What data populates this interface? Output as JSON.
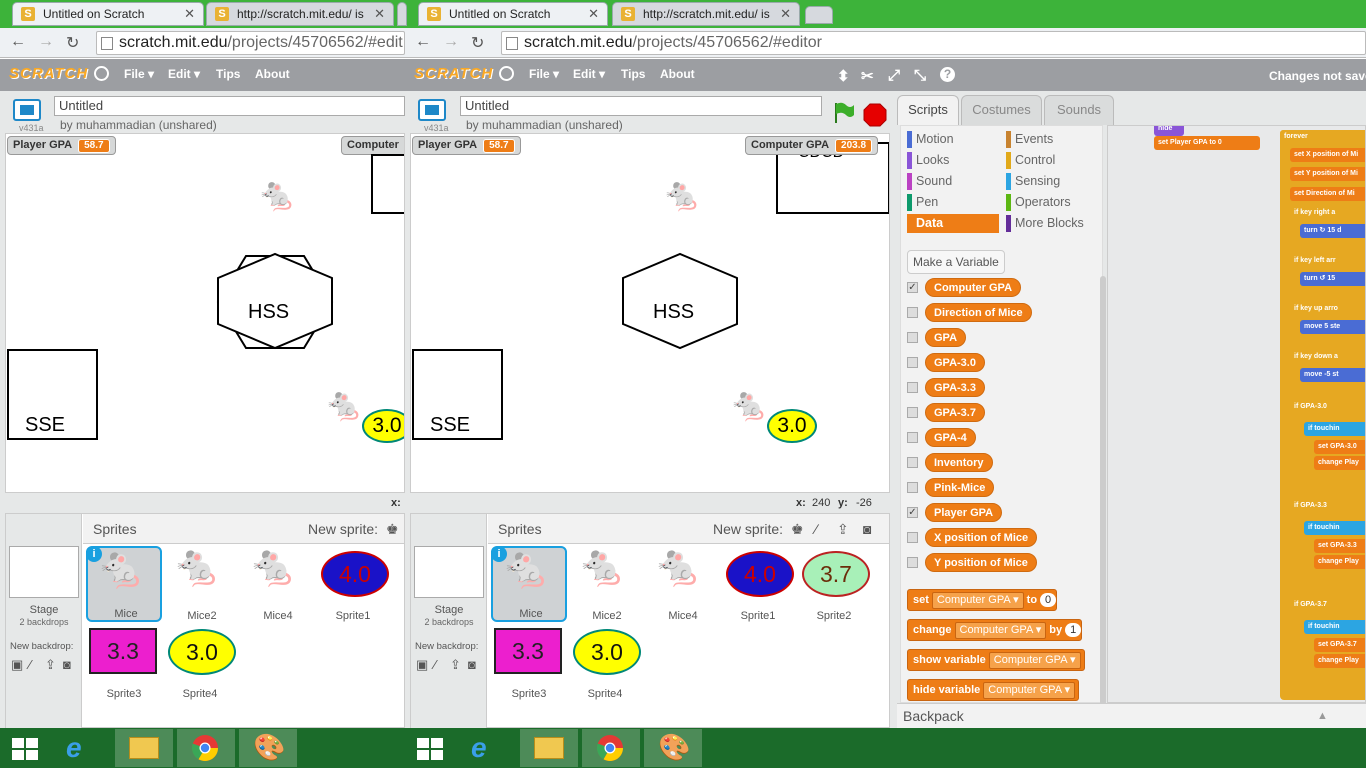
{
  "tabs": [
    {
      "label": "Untitled on Scratch",
      "active": true
    },
    {
      "label": "http://scratch.mit.edu/ is",
      "active": false
    },
    {
      "label": "Untitled on Scratch",
      "active": true
    },
    {
      "label": "http://scratch.mit.edu/ is",
      "active": false
    }
  ],
  "address_left": {
    "host": "scratch.mit.edu",
    "path": "/projects/45706562/#edit"
  },
  "address_right": {
    "host": "scratch.mit.edu",
    "path": "/projects/45706562/#editor"
  },
  "menu": {
    "logo": "SCRATCH",
    "file": "File ▾",
    "edit": "Edit ▾",
    "tips": "Tips",
    "about": "About",
    "status": "Changes not save"
  },
  "project": {
    "title": "Untitled",
    "byline": "by muhammadian (unshared)",
    "version": "v431a"
  },
  "monitors": {
    "player_label": "Player GPA",
    "player_value": "58.7",
    "computer_label": "Computer GPA",
    "computer_value": "203.8",
    "computer_label_short": "Computer"
  },
  "stage": {
    "hss": "HSS",
    "sse": "SSE",
    "cdcd": "CDCD",
    "gpa_sprite": "3.0"
  },
  "coords": {
    "x_label": "x:",
    "x_val": "240",
    "y_label": "y:",
    "y_val": "-26"
  },
  "sprites_panel": {
    "title": "Sprites",
    "new_sprite": "New sprite:",
    "stage_label": "Stage",
    "stage_sub": "2 backdrops",
    "new_backdrop": "New backdrop:"
  },
  "sprites": [
    {
      "name": "Mice",
      "text": ""
    },
    {
      "name": "Mice2",
      "text": ""
    },
    {
      "name": "Mice4",
      "text": ""
    },
    {
      "name": "Sprite1",
      "text": "4.0"
    },
    {
      "name": "Sprite2",
      "text": "3.7"
    },
    {
      "name": "Sprite3",
      "text": "3.3"
    },
    {
      "name": "Sprite4",
      "text": "3.0"
    }
  ],
  "editor_tabs": {
    "scripts": "Scripts",
    "costumes": "Costumes",
    "sounds": "Sounds"
  },
  "categories": [
    {
      "label": "Motion",
      "color": "#4a6cd4"
    },
    {
      "label": "Looks",
      "color": "#8a55d7"
    },
    {
      "label": "Sound",
      "color": "#bb42c3"
    },
    {
      "label": "Pen",
      "color": "#0e9a6c"
    },
    {
      "label": "Data",
      "color": "#ee7d16"
    },
    {
      "label": "Events",
      "color": "#c88330"
    },
    {
      "label": "Control",
      "color": "#e1a91a"
    },
    {
      "label": "Sensing",
      "color": "#2ca5e2"
    },
    {
      "label": "Operators",
      "color": "#5cb712"
    },
    {
      "label": "More Blocks",
      "color": "#632d99"
    }
  ],
  "make_variable": "Make a Variable",
  "variables": [
    {
      "name": "Computer GPA",
      "checked": true
    },
    {
      "name": "Direction of Mice",
      "checked": false
    },
    {
      "name": "GPA",
      "checked": false
    },
    {
      "name": "GPA-3.0",
      "checked": false
    },
    {
      "name": "GPA-3.3",
      "checked": false
    },
    {
      "name": "GPA-3.7",
      "checked": false
    },
    {
      "name": "GPA-4",
      "checked": false
    },
    {
      "name": "Inventory",
      "checked": false
    },
    {
      "name": "Pink-Mice",
      "checked": false
    },
    {
      "name": "Player GPA",
      "checked": true
    },
    {
      "name": "X position of Mice",
      "checked": false
    },
    {
      "name": "Y position of Mice",
      "checked": false
    }
  ],
  "palette_blocks": {
    "set": "set",
    "set_var": "Computer GPA",
    "set_to": "to",
    "set_val": "0",
    "change": "change",
    "change_var": "Computer GPA",
    "change_by": "by",
    "change_val": "1",
    "show": "show variable",
    "show_var": "Computer GPA",
    "hide": "hide variable",
    "hide_var": "Computer GPA"
  },
  "script_blocks": {
    "hide": "hide",
    "set_player": "set  Player GPA  to 0",
    "forever": "forever",
    "setx": "set  X position of Mi",
    "sety": "set  Y position of Mi",
    "setdir": "set  Direction of Mi",
    "if_right": "if   key  right a",
    "turn_cw": "turn ↻  15  d",
    "if_left": "if   key  left arr",
    "turn_ccw": "turn ↺  15",
    "if_up": "if   key  up arro",
    "move_up": "move  5  ste",
    "if_down": "if   key  down a",
    "move_down": "move  -5  st",
    "if_30": "if   GPA-3.0",
    "touch1": "if   touchin",
    "set_301": "set  GPA-3.0",
    "change1": "change  Play",
    "if_33": "if   GPA-3.3",
    "touch2": "if   touchin",
    "set_33": "set  GPA-3.3",
    "change2": "change  Play",
    "if_37": "if   GPA-3.7",
    "touch3": "if   touchin",
    "set_37": "set  GPA-3.7",
    "change3": "change  Play"
  },
  "backpack": "Backpack"
}
